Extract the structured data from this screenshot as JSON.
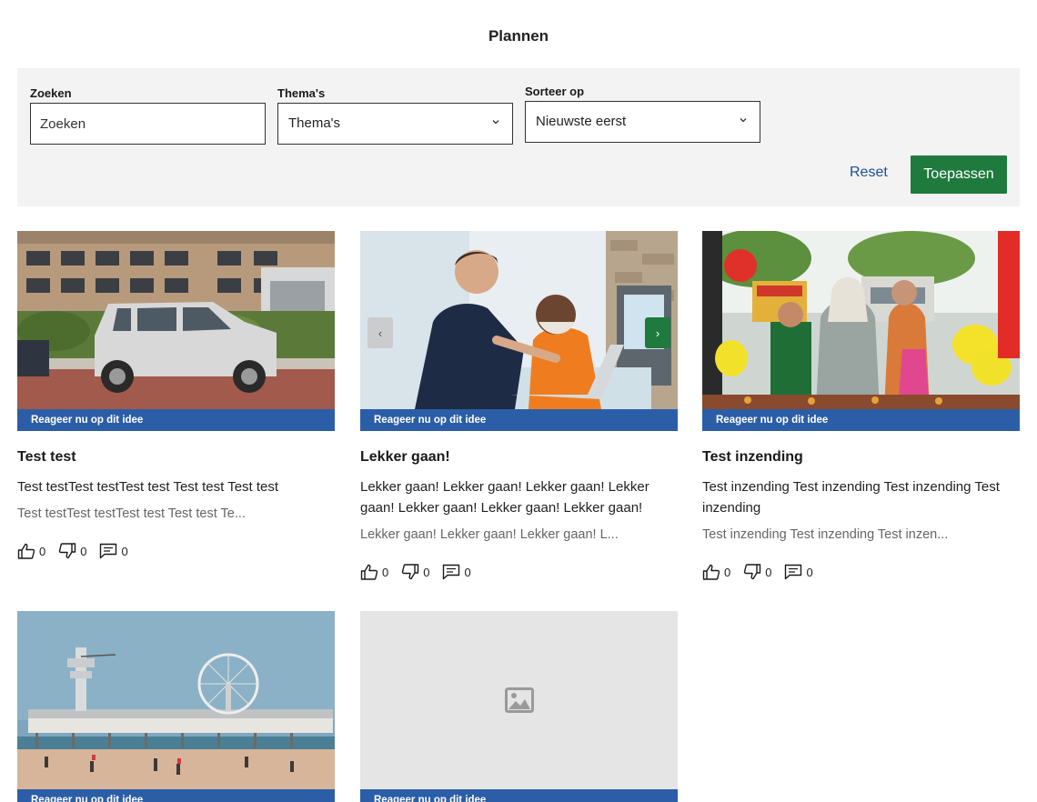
{
  "page": {
    "title": "Plannen"
  },
  "filters": {
    "search": {
      "label": "Zoeken",
      "placeholder": "Zoeken"
    },
    "themes": {
      "label": "Thema's",
      "value": "Thema's"
    },
    "sort": {
      "label": "Sorteer op",
      "value": "Nieuwste eerst"
    },
    "reset_label": "Reset",
    "apply_label": "Toepassen"
  },
  "cards": [
    {
      "banner": "Reageer nu op dit idee",
      "title": "Test test",
      "summary": "Test testTest testTest test Test test Test test",
      "description": "Test testTest testTest test Test test Te...",
      "likes": "0",
      "dislikes": "0",
      "comments": "0"
    },
    {
      "banner": "Reageer nu op dit idee",
      "title": "Lekker gaan!",
      "summary": "Lekker gaan! Lekker gaan! Lekker gaan! Lekker gaan! Lekker gaan! Lekker gaan! Lekker gaan!",
      "description": "Lekker gaan! Lekker gaan! Lekker gaan! L...",
      "likes": "0",
      "dislikes": "0",
      "comments": "0"
    },
    {
      "banner": "Reageer nu op dit idee",
      "title": "Test inzending",
      "summary": "Test inzending Test inzending Test inzending Test inzending",
      "description": "Test inzending Test inzending Test inzen...",
      "likes": "0",
      "dislikes": "0",
      "comments": "0"
    },
    {
      "banner": "Reageer nu op dit idee"
    },
    {
      "banner": "Reageer nu op dit idee"
    }
  ],
  "colors": {
    "primary": "#2b5ea7",
    "accent": "#1f7a3d",
    "panel": "#f3f3f3"
  },
  "icons": [
    "chevron-down-icon",
    "thumbs-up-icon",
    "thumbs-down-icon",
    "comment-icon",
    "image-placeholder-icon",
    "chevron-left-icon",
    "chevron-right-icon"
  ]
}
